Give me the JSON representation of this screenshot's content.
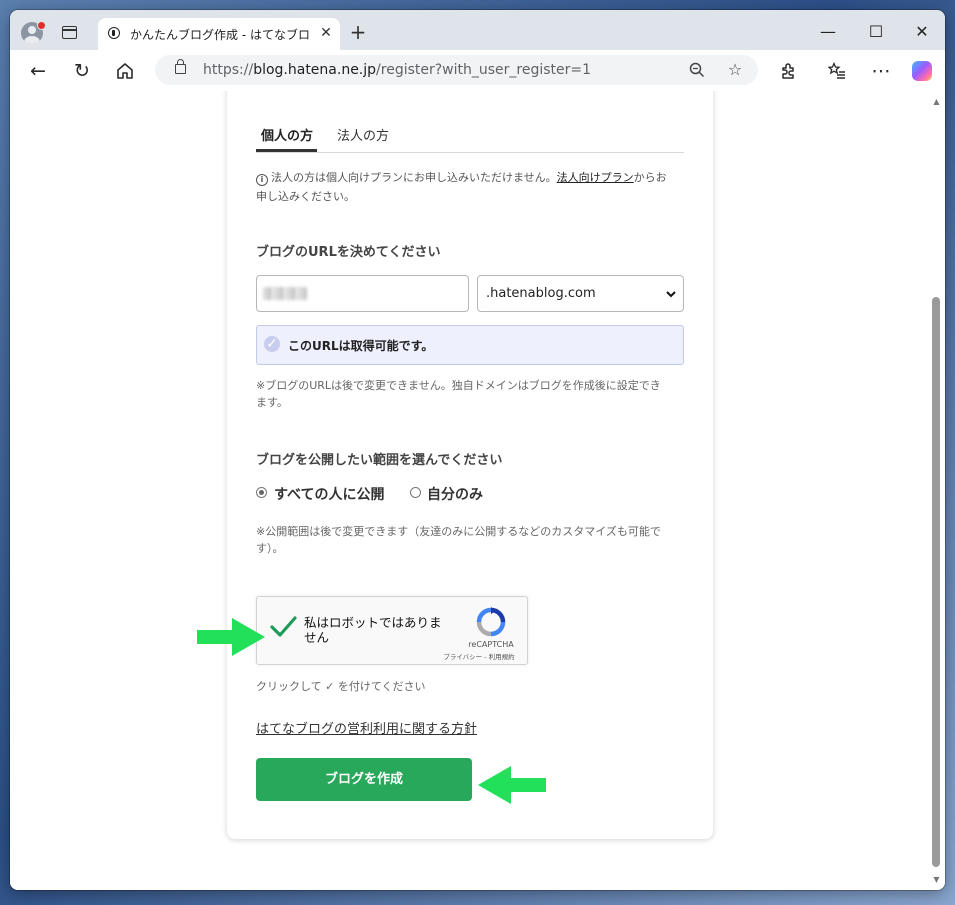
{
  "browser": {
    "tab_title": "かんたんブログ作成 - はてなブログ",
    "tab_close": "✕",
    "new_tab": "+",
    "url_scheme": "https://",
    "url_host": "blog.hatena.ne.jp",
    "url_path": "/register?with_user_register=1",
    "window_controls": {
      "minimize": "—",
      "maximize": "☐",
      "close": "✕"
    }
  },
  "page": {
    "tabs": [
      {
        "label": "個人の方",
        "active": true
      },
      {
        "label": "法人の方",
        "active": false
      }
    ],
    "notice_before": "法人の方は個人向けプランにお申し込みいただけません。",
    "notice_link": "法人向けプラン",
    "notice_after": "からお申し込みください。",
    "url_section_title": "ブログのURLを決めてください",
    "domain_value": ".hatenablog.com",
    "available_text": "このURLは取得可能です。",
    "url_note": "※ブログのURLは後で変更できません。独自ドメインはブログを作成後に設定できます。",
    "visibility_title": "ブログを公開したい範囲を選んでください",
    "visibility_options": [
      {
        "label": "すべての人に公開",
        "selected": true
      },
      {
        "label": "自分のみ",
        "selected": false
      }
    ],
    "visibility_note": "※公開範囲は後で変更できます（友達のみに公開するなどのカスタマイズも可能です）。",
    "recaptcha": {
      "label": "私はロボットではありません",
      "checked": true,
      "brand": "reCAPTCHA",
      "links": "プライバシー - 利用規約"
    },
    "hint": "クリックして ✓ を付けてください",
    "policy_link": "はてなブログの営利利用に関する方針",
    "create_button": "ブログを作成"
  },
  "colors": {
    "primary_button": "#27a85a",
    "annotation_arrow": "#22e05a",
    "available_bg": "#eef0fd"
  }
}
